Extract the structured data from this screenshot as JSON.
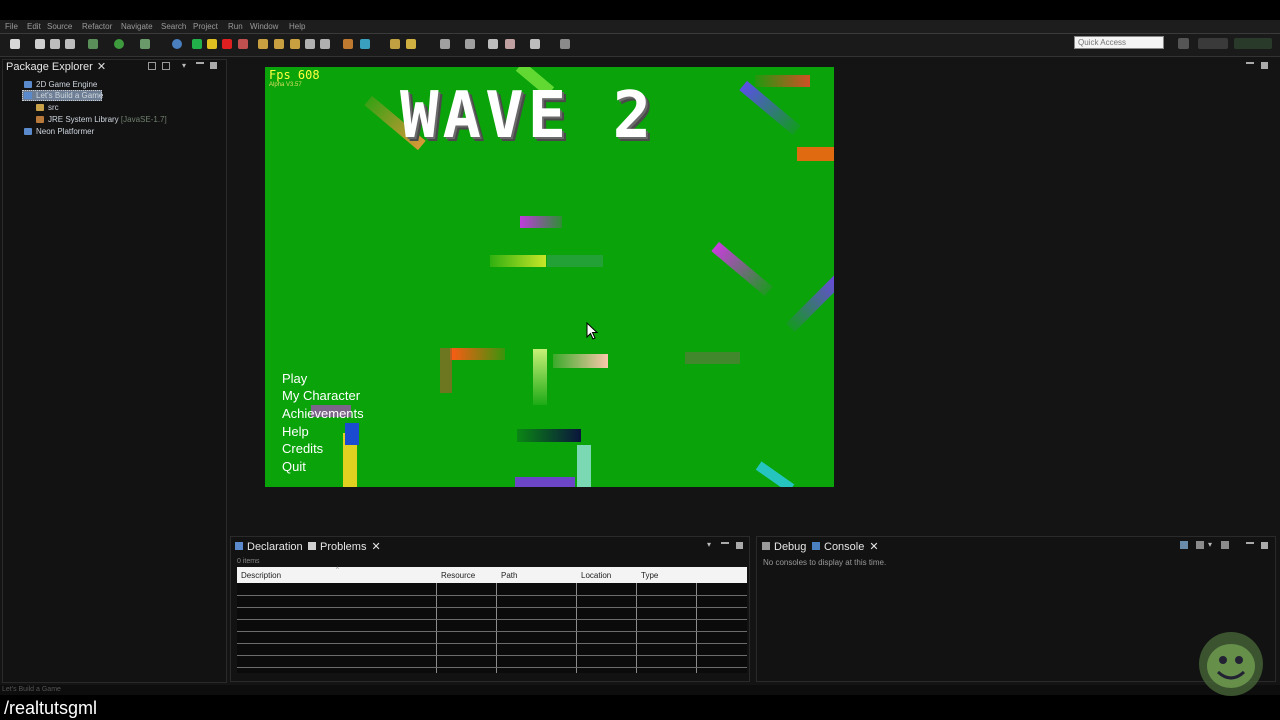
{
  "menubar": {
    "items": [
      "File",
      "Edit",
      "Source",
      "Refactor",
      "Navigate",
      "Search",
      "Project",
      "Run",
      "Window",
      "Help"
    ]
  },
  "toolbar": {
    "quick_access_placeholder": "Quick Access"
  },
  "package_explorer": {
    "tab_label": "Package Explorer",
    "items": [
      {
        "label": "2D Game Engine",
        "icon": "project-folder-icon"
      },
      {
        "label": "Let's Build a Game",
        "icon": "project-folder-icon",
        "selected": true
      },
      {
        "label": "src",
        "icon": "package-folder-icon"
      },
      {
        "label": "JRE System Library",
        "hint": "[JavaSE-1.7]",
        "icon": "library-icon"
      },
      {
        "label": "Neon Platformer",
        "icon": "project-folder-icon"
      }
    ]
  },
  "game": {
    "fps_label": "Fps 608",
    "alpha_label": "Alpha V3.57",
    "wave_title": "WAVE 2",
    "menu": [
      "Play",
      "My Character",
      "Achievements",
      "Help",
      "Credits",
      "Quit"
    ],
    "background_color": "#0aa30a"
  },
  "problems_panel": {
    "tabs": [
      "Declaration",
      "Problems"
    ],
    "items_count": "0 items",
    "columns": [
      "Description",
      "Resource",
      "Path",
      "Location",
      "Type"
    ]
  },
  "console_panel": {
    "tabs": [
      "Debug",
      "Console"
    ],
    "message": "No consoles to display at this time."
  },
  "status_bar": {
    "text": "Let's Build a Game"
  },
  "overlay": {
    "channel_label": "/realtutsgml"
  },
  "colors": {
    "ide_bg": "#141414",
    "game_green": "#0aa30a",
    "fps_yellow": "#ffff40"
  }
}
